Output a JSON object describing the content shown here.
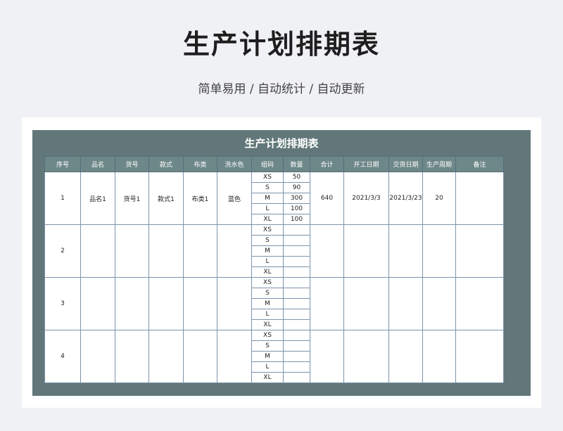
{
  "page": {
    "title": "生产计划排期表",
    "subtitle": "简单易用 / 自动统计 / 自动更新"
  },
  "sheet": {
    "title": "生产计划排期表",
    "headers": [
      "序号",
      "品名",
      "货号",
      "款式",
      "布类",
      "洗水色",
      "组码",
      "数量",
      "合计",
      "开工日期",
      "交货日期",
      "生产周期",
      "备注"
    ],
    "sizes": [
      "XS",
      "S",
      "M",
      "L",
      "XL"
    ],
    "rows": [
      {
        "no": "1",
        "name": "品名1",
        "item_no": "货号1",
        "style": "款式1",
        "fabric": "布类1",
        "wash_color": "蓝色",
        "qty": [
          "50",
          "90",
          "300",
          "100",
          "100"
        ],
        "total": "640",
        "start_date": "2021/3/3",
        "delivery_date": "2021/3/23",
        "cycle": "20",
        "remark": ""
      },
      {
        "no": "2",
        "name": "",
        "item_no": "",
        "style": "",
        "fabric": "",
        "wash_color": "",
        "qty": [
          "",
          "",
          "",
          "",
          ""
        ],
        "total": "",
        "start_date": "",
        "delivery_date": "",
        "cycle": "",
        "remark": ""
      },
      {
        "no": "3",
        "name": "",
        "item_no": "",
        "style": "",
        "fabric": "",
        "wash_color": "",
        "qty": [
          "",
          "",
          "",
          "",
          ""
        ],
        "total": "",
        "start_date": "",
        "delivery_date": "",
        "cycle": "",
        "remark": ""
      },
      {
        "no": "4",
        "name": "",
        "item_no": "",
        "style": "",
        "fabric": "",
        "wash_color": "",
        "qty": [
          "",
          "",
          "",
          "",
          ""
        ],
        "total": "",
        "start_date": "",
        "delivery_date": "",
        "cycle": "",
        "remark": ""
      }
    ]
  }
}
